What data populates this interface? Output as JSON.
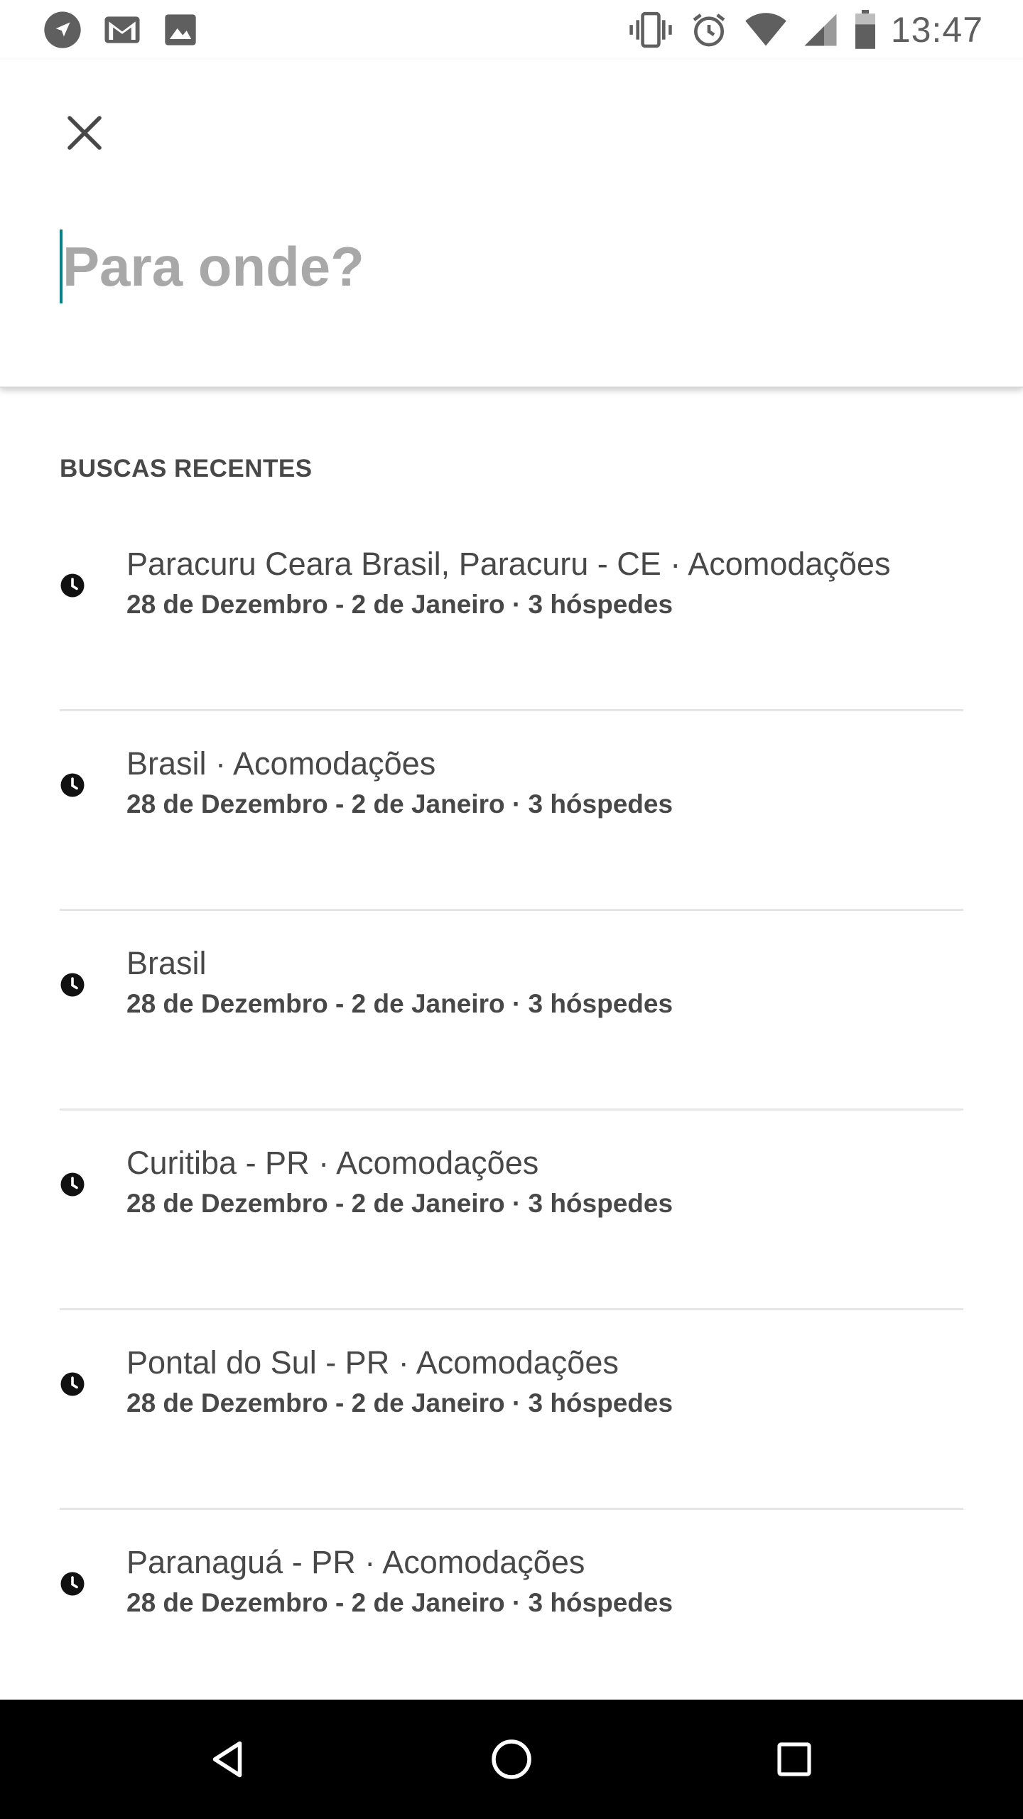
{
  "status_bar": {
    "time": "13:47",
    "left_icons": [
      "navigation-icon",
      "gmail-icon",
      "image-icon"
    ],
    "right_icons": [
      "vibrate-icon",
      "alarm-icon",
      "wifi-icon",
      "signal-icon",
      "battery-icon"
    ]
  },
  "search": {
    "placeholder": "Para onde?",
    "value": ""
  },
  "recent": {
    "title": "BUSCAS RECENTES",
    "items": [
      {
        "title": "Paracuru Ceara Brasil, Paracuru - CE · Acomodações",
        "subtitle": "28 de Dezembro - 2 de Janeiro · 3 hóspedes"
      },
      {
        "title": "Brasil · Acomodações",
        "subtitle": "28 de Dezembro - 2 de Janeiro · 3 hóspedes"
      },
      {
        "title": "Brasil",
        "subtitle": "28 de Dezembro - 2 de Janeiro · 3 hóspedes"
      },
      {
        "title": "Curitiba - PR · Acomodações",
        "subtitle": "28 de Dezembro - 2 de Janeiro · 3 hóspedes"
      },
      {
        "title": "Pontal do Sul - PR · Acomodações",
        "subtitle": "28 de Dezembro - 2 de Janeiro · 3 hóspedes"
      },
      {
        "title": "Paranaguá - PR · Acomodações",
        "subtitle": "28 de Dezembro - 2 de Janeiro · 3 hóspedes"
      }
    ]
  },
  "colors": {
    "accent_cursor": "#00838a",
    "text": "#484848",
    "placeholder": "#a8a8a8",
    "nav_bar": "#000000"
  },
  "nav_bar": {
    "buttons": [
      "back-icon",
      "home-icon",
      "recents-icon"
    ]
  }
}
